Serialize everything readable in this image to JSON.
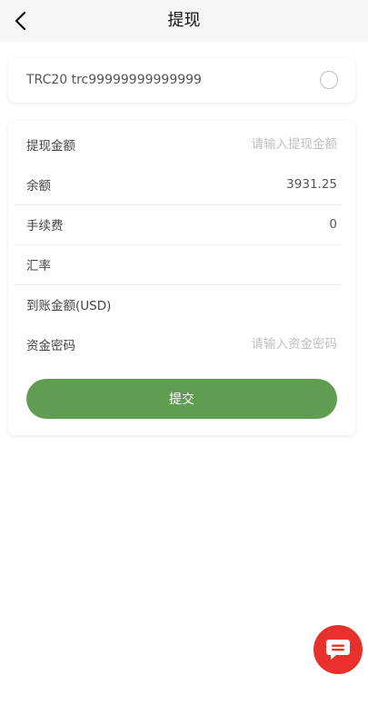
{
  "header": {
    "title": "提现",
    "back_icon": "chevron-left-icon"
  },
  "address": {
    "text": "TRC20 trc99999999999999",
    "selected": false
  },
  "form": {
    "withdraw_amount": {
      "label": "提现金额",
      "placeholder": "请输入提现金额",
      "value": ""
    },
    "balance": {
      "label": "余额",
      "value": "3931.25"
    },
    "fee": {
      "label": "手续费",
      "value": "0"
    },
    "exchange_rate": {
      "label": "汇率",
      "value": ""
    },
    "received_amount": {
      "label": "到账金额(USD)",
      "value": ""
    },
    "fund_password": {
      "label": "资金密码",
      "placeholder": "请输入资金密码",
      "value": ""
    }
  },
  "submit": {
    "label": "提交"
  },
  "chat": {
    "icon": "chat-icon"
  },
  "colors": {
    "accent": "#5f9e51",
    "chat_fab": "#e8302c",
    "header_bg": "#f6f6f6"
  }
}
